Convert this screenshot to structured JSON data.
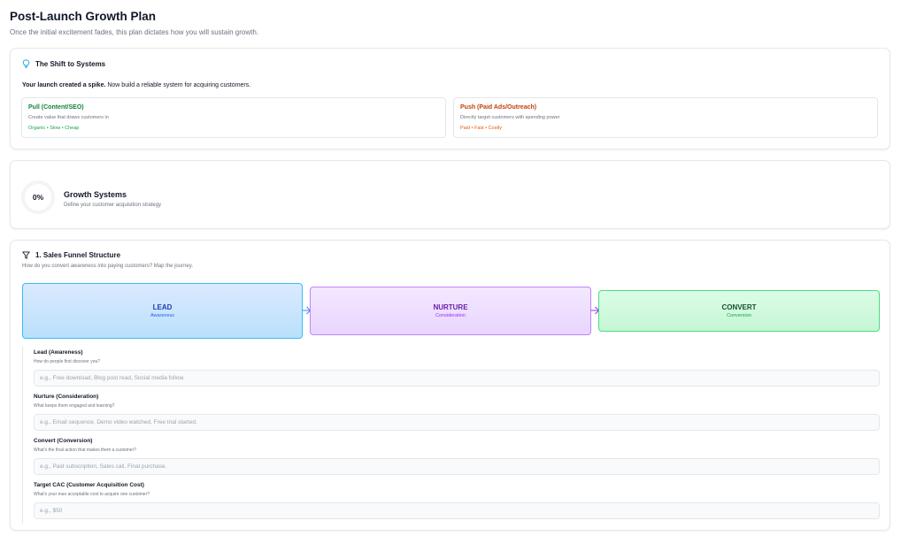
{
  "page": {
    "title": "Post-Launch Growth Plan",
    "subtitle": "Once the initial excitement fades, this plan dictates how you will sustain growth."
  },
  "shift": {
    "heading": "The Shift to Systems",
    "intro_bold": "Your launch created a spike.",
    "intro_rest": " Now build a reliable system for acquiring customers.",
    "pull": {
      "title": "Pull (Content/SEO)",
      "description": "Create value that draws customers in",
      "tags": "Organic • Slow • Cheap"
    },
    "push": {
      "title": "Push (Paid Ads/Outreach)",
      "description": "Directly target customers with spending power",
      "tags": "Paid • Fast • Costly"
    }
  },
  "growth": {
    "progress": "0%",
    "title": "Growth Systems",
    "subtitle": "Define your customer acquisition strategy"
  },
  "funnel": {
    "heading": "1. Sales Funnel Structure",
    "subtitle": "How do you convert awareness into paying customers? Map the journey.",
    "stages": [
      {
        "name": "LEAD",
        "sub": "Awareness"
      },
      {
        "name": "NURTURE",
        "sub": "Consideration"
      },
      {
        "name": "CONVERT",
        "sub": "Conversion"
      }
    ],
    "fields": [
      {
        "label": "Lead (Awareness)",
        "help": "How do people first discover you?",
        "placeholder": "e.g., Free download, Blog post read, Social media follow.",
        "value": ""
      },
      {
        "label": "Nurture (Consideration)",
        "help": "What keeps them engaged and learning?",
        "placeholder": "e.g., Email sequence, Demo video watched, Free trial started.",
        "value": ""
      },
      {
        "label": "Convert (Conversion)",
        "help": "What's the final action that makes them a customer?",
        "placeholder": "e.g., Paid subscription, Sales call, Final purchase.",
        "value": ""
      },
      {
        "label": "Target CAC (Customer Acquisition Cost)",
        "help": "What's your max acceptable cost to acquire one customer?",
        "placeholder": "e.g., $50",
        "value": ""
      }
    ]
  },
  "colors": {
    "pull_accent": "#15803d",
    "push_accent": "#c2410c",
    "lead_stage": "#bae0fb",
    "nurture_stage": "#e9d5ff",
    "convert_stage": "#c6f6d5"
  },
  "icons": {
    "shift": "lightbulb-icon",
    "funnel": "funnel-icon",
    "stage_arrow": "arrow-right-icon"
  }
}
